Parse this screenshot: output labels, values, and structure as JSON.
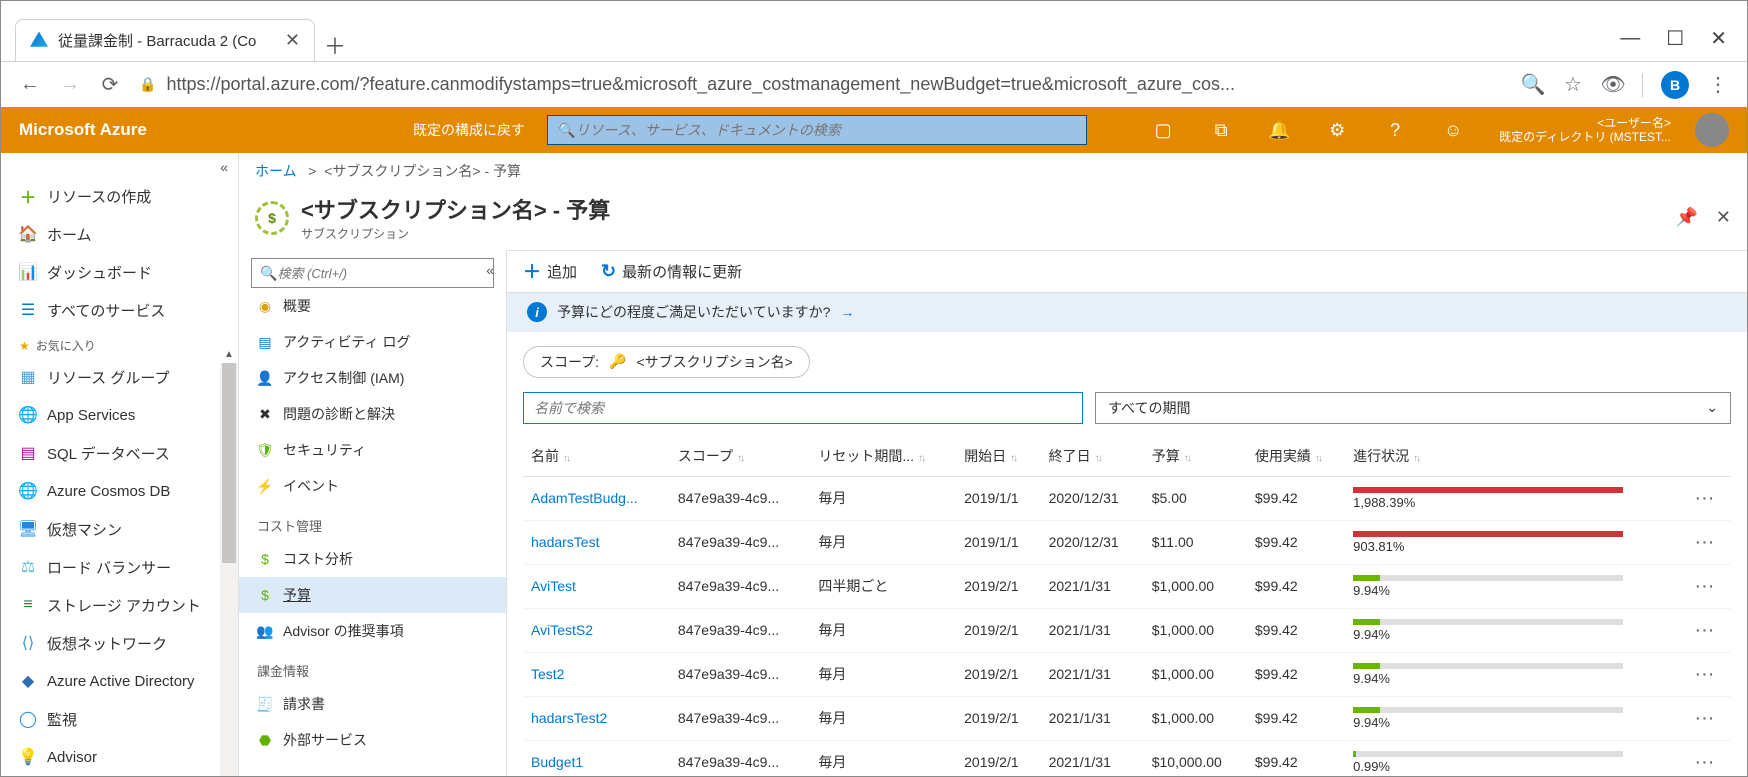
{
  "browser": {
    "tab_title": "従量課金制 - Barracuda 2 (Co",
    "url": "https://portal.azure.com/?feature.canmodifystamps=true&microsoft_azure_costmanagement_newBudget=true&microsoft_azure_cos...",
    "profile_initial": "B",
    "new_tab": "＋",
    "close_tab": "✕"
  },
  "topbar": {
    "brand": "Microsoft Azure",
    "reset_label": "既定の構成に戻す",
    "search_placeholder": "リソース、サービス、ドキュメントの検索",
    "user_line1": "<ユーザー名>",
    "user_line2": "既定のディレクトリ (MSTEST..."
  },
  "leftnav": {
    "create": "リソースの作成",
    "home": "ホーム",
    "dashboard": "ダッシュボード",
    "all": "すべてのサービス",
    "fav_heading": "お気に入り",
    "items": [
      "リソース グループ",
      "App Services",
      "SQL データベース",
      "Azure Cosmos DB",
      "仮想マシン",
      "ロード バランサー",
      "ストレージ アカウント",
      "仮想ネットワーク",
      "Azure Active Directory",
      "監視",
      "Advisor"
    ]
  },
  "crumb": {
    "home": "ホーム",
    "sep": ">",
    "rest": "<サブスクリプション名> - 予算"
  },
  "blade": {
    "title": "<サブスクリプション名> - 予算",
    "subtitle": "サブスクリプション",
    "icon_text": "$"
  },
  "midnav": {
    "search_placeholder": "検索 (Ctrl+/)",
    "overview": "概要",
    "activity": "アクティビティ ログ",
    "iam": "アクセス制御 (IAM)",
    "diag": "問題の診断と解決",
    "security": "セキュリティ",
    "events": "イベント",
    "cost_heading": "コスト管理",
    "cost_analysis": "コスト分析",
    "budgets": "予算",
    "advisor": "Advisor の推奨事項",
    "billing_heading": "課金情報",
    "invoices": "請求書",
    "external": "外部サービス"
  },
  "commands": {
    "add": "追加",
    "refresh": "最新の情報に更新"
  },
  "info": {
    "text": "予算にどの程度ご満足いただいていますか?"
  },
  "scope": {
    "label": "スコープ:",
    "value": "<サブスクリプション名>"
  },
  "filters": {
    "name_placeholder": "名前で検索",
    "period": "すべての期間"
  },
  "columns": {
    "name": "名前",
    "scope": "スコープ",
    "reset": "リセット期間...",
    "start": "開始日",
    "end": "終了日",
    "budget": "予算",
    "actual": "使用実績",
    "progress": "進行状況"
  },
  "rows": [
    {
      "name": "AdamTestBudg...",
      "scope": "847e9a39-4c9...",
      "reset": "毎月",
      "start": "2019/1/1",
      "end": "2020/12/31",
      "budget": "$5.00",
      "actual": "$99.42",
      "pct": "1,988.39%",
      "pctNum": 1988.39
    },
    {
      "name": "hadarsTest",
      "scope": "847e9a39-4c9...",
      "reset": "毎月",
      "start": "2019/1/1",
      "end": "2020/12/31",
      "budget": "$11.00",
      "actual": "$99.42",
      "pct": "903.81%",
      "pctNum": 903.81
    },
    {
      "name": "AviTest",
      "scope": "847e9a39-4c9...",
      "reset": "四半期ごと",
      "start": "2019/2/1",
      "end": "2021/1/31",
      "budget": "$1,000.00",
      "actual": "$99.42",
      "pct": "9.94%",
      "pctNum": 9.94
    },
    {
      "name": "AviTestS2",
      "scope": "847e9a39-4c9...",
      "reset": "毎月",
      "start": "2019/2/1",
      "end": "2021/1/31",
      "budget": "$1,000.00",
      "actual": "$99.42",
      "pct": "9.94%",
      "pctNum": 9.94
    },
    {
      "name": "Test2",
      "scope": "847e9a39-4c9...",
      "reset": "毎月",
      "start": "2019/2/1",
      "end": "2021/1/31",
      "budget": "$1,000.00",
      "actual": "$99.42",
      "pct": "9.94%",
      "pctNum": 9.94
    },
    {
      "name": "hadarsTest2",
      "scope": "847e9a39-4c9...",
      "reset": "毎月",
      "start": "2019/2/1",
      "end": "2021/1/31",
      "budget": "$1,000.00",
      "actual": "$99.42",
      "pct": "9.94%",
      "pctNum": 9.94
    },
    {
      "name": "Budget1",
      "scope": "847e9a39-4c9...",
      "reset": "毎月",
      "start": "2019/2/1",
      "end": "2021/1/31",
      "budget": "$10,000.00",
      "actual": "$99.42",
      "pct": "0.99%",
      "pctNum": 0.99
    }
  ]
}
